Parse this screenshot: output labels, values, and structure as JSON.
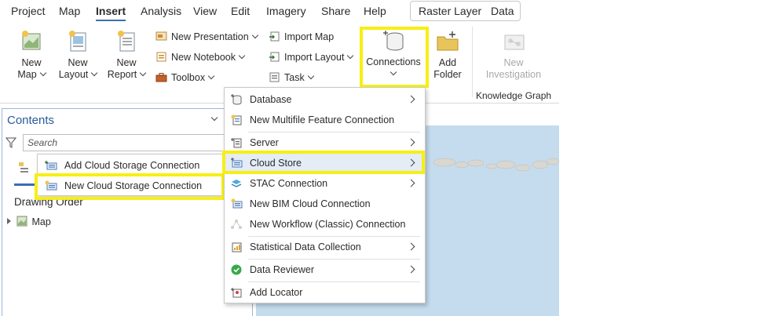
{
  "tabs": {
    "project": "Project",
    "map": "Map",
    "insert": "Insert",
    "analysis": "Analysis",
    "view": "View",
    "edit": "Edit",
    "imagery": "Imagery",
    "share": "Share",
    "help": "Help",
    "raster_layer": "Raster Layer",
    "data": "Data"
  },
  "ribbon": {
    "new_map": [
      "New",
      "Map"
    ],
    "new_layout": [
      "New",
      "Layout"
    ],
    "new_report": [
      "New",
      "Report"
    ],
    "new_presentation": "New Presentation",
    "new_notebook": "New Notebook",
    "toolbox": "Toolbox",
    "import_map": "Import Map",
    "import_layout": "Import Layout",
    "task": "Task",
    "connections": "Connections",
    "add_folder": [
      "Add",
      "Folder"
    ],
    "new_investigation": [
      "New",
      "Investigation"
    ],
    "knowledge_graph_group": "Knowledge Graph"
  },
  "contents": {
    "title": "Contents",
    "search_placeholder": "Search",
    "drawing_order": "Drawing Order",
    "map_item": "Map"
  },
  "connections_menu": {
    "items": [
      {
        "label": "Database",
        "has_submenu": true
      },
      {
        "label": "New Multifile Feature Connection",
        "has_submenu": false
      },
      {
        "label": "Server",
        "has_submenu": true
      },
      {
        "label": "Cloud Store",
        "has_submenu": true
      },
      {
        "label": "STAC Connection",
        "has_submenu": true
      },
      {
        "label": "New BIM Cloud Connection",
        "has_submenu": false
      },
      {
        "label": "New Workflow (Classic) Connection",
        "has_submenu": false,
        "disabled": true
      },
      {
        "label": "Statistical Data Collection",
        "has_submenu": true
      },
      {
        "label": "Data Reviewer",
        "has_submenu": true
      },
      {
        "label": "Add Locator",
        "has_submenu": false
      }
    ]
  },
  "cloud_store_submenu": {
    "items": [
      {
        "label": "Add Cloud Storage Connection"
      },
      {
        "label": "New Cloud Storage Connection"
      }
    ]
  },
  "colors": {
    "highlight": "#f7ef14",
    "accent": "#3a6fb3",
    "contents_title": "#2a5c9a",
    "map_water": "#c4dced"
  }
}
